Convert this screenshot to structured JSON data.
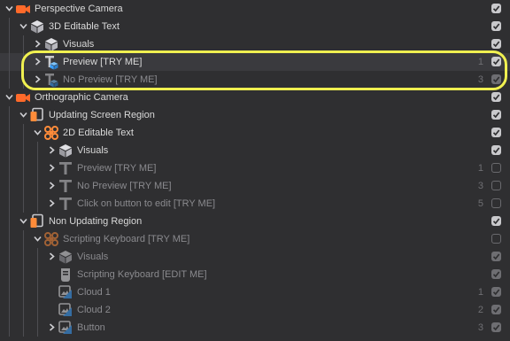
{
  "colors": {
    "background": "#2f2f31",
    "camera_icon": "#ff6a2a",
    "group_icon": "#ff8c3a",
    "text_icon_badge": "#3aa0ff",
    "highlight": "#f0f050"
  },
  "rows": [
    {
      "label": "Perspective Camera",
      "icon": "camera-icon",
      "chevron": "down",
      "checked": true,
      "dim": false,
      "count": ""
    },
    {
      "label": "3D Editable Text",
      "icon": "cube-icon",
      "chevron": "down",
      "checked": true,
      "dim": false,
      "count": ""
    },
    {
      "label": "Visuals",
      "icon": "cube-icon",
      "chevron": "right",
      "checked": true,
      "dim": false,
      "count": ""
    },
    {
      "label": "Preview [TRY ME]",
      "icon": "text-3d-icon",
      "chevron": "right",
      "checked": true,
      "dim": false,
      "count": "1"
    },
    {
      "label": "No Preview [TRY ME]",
      "icon": "text-3d-icon",
      "chevron": "right",
      "checked": true,
      "dim": true,
      "count": "3"
    },
    {
      "label": "Orthographic Camera",
      "icon": "camera-icon",
      "chevron": "down",
      "checked": true,
      "dim": false,
      "count": ""
    },
    {
      "label": "Updating Screen Region",
      "icon": "screen-region-icon",
      "chevron": "down",
      "checked": true,
      "dim": false,
      "count": ""
    },
    {
      "label": "2D Editable Text",
      "icon": "group-icon",
      "chevron": "down",
      "checked": true,
      "dim": false,
      "count": ""
    },
    {
      "label": "Visuals",
      "icon": "cube-icon",
      "chevron": "right",
      "checked": true,
      "dim": false,
      "count": ""
    },
    {
      "label": "Preview [TRY ME]",
      "icon": "text-icon",
      "chevron": "right",
      "checked": false,
      "dim": true,
      "count": "1"
    },
    {
      "label": "No Preview [TRY ME]",
      "icon": "text-icon",
      "chevron": "right",
      "checked": false,
      "dim": true,
      "count": "3"
    },
    {
      "label": "Click on button to edit [TRY ME]",
      "icon": "text-icon",
      "chevron": "right",
      "checked": false,
      "dim": true,
      "count": "5"
    },
    {
      "label": "Non Updating Region",
      "icon": "screen-region-icon",
      "chevron": "down",
      "checked": true,
      "dim": false,
      "count": ""
    },
    {
      "label": "Scripting Keyboard [TRY ME]",
      "icon": "group-icon",
      "chevron": "down",
      "checked": false,
      "dim": true,
      "count": ""
    },
    {
      "label": "Visuals",
      "icon": "cube-icon",
      "chevron": "right",
      "checked": true,
      "dim": true,
      "count": ""
    },
    {
      "label": "Scripting Keyboard [EDIT ME]",
      "icon": "script-icon",
      "chevron": "none",
      "checked": true,
      "dim": true,
      "count": ""
    },
    {
      "label": "Cloud 1",
      "icon": "image-icon",
      "chevron": "none",
      "checked": true,
      "dim": true,
      "count": "1"
    },
    {
      "label": "Cloud 2",
      "icon": "image-icon",
      "chevron": "none",
      "checked": true,
      "dim": true,
      "count": "2"
    },
    {
      "label": "Button",
      "icon": "image-icon",
      "chevron": "right",
      "checked": true,
      "dim": true,
      "count": "3"
    }
  ]
}
